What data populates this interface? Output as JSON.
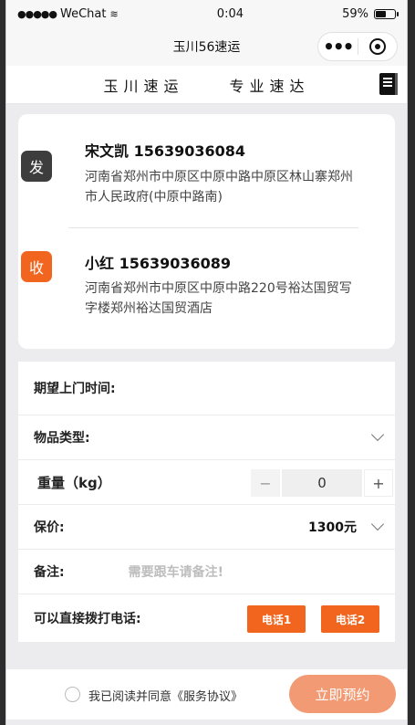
{
  "status": {
    "carrier": "WeChat",
    "time": "0:04",
    "battery": "59%",
    "battery_level": 0.59
  },
  "nav": {
    "title": "玉川56速运"
  },
  "brand": {
    "left": "玉川速运",
    "right": "专业速达"
  },
  "sender": {
    "badge": "发",
    "name_phone": "宋文凯 15639036084",
    "address": "河南省郑州市中原区中原中路中原区林山寨郑州市人民政府(中原中路南)"
  },
  "receiver": {
    "badge": "收",
    "name_phone": "小红 15639036089",
    "address": "河南省郑州市中原区中原中路220号裕达国贸写字楼郑州裕达国贸酒店"
  },
  "form": {
    "pickup_time_label": "期望上门时间:",
    "goods_type_label": "物品类型:",
    "weight_label": "重量（kg）",
    "weight_minus": "−",
    "weight_value": "0",
    "weight_plus": "+",
    "insured_label": "保价:",
    "insured_value": "1300元",
    "remark_label": "备注:",
    "remark_placeholder": "需要跟车请备注!",
    "call_label": "可以直接拨打电话:",
    "call1": "电话1",
    "call2": "电话2"
  },
  "footer": {
    "agreement": "我已阅读并同意《服务协议》",
    "submit": "立即预约"
  },
  "colors": {
    "accent": "#f2651f",
    "submit": "#f29a73",
    "sender_badge": "#3d3d3d"
  }
}
